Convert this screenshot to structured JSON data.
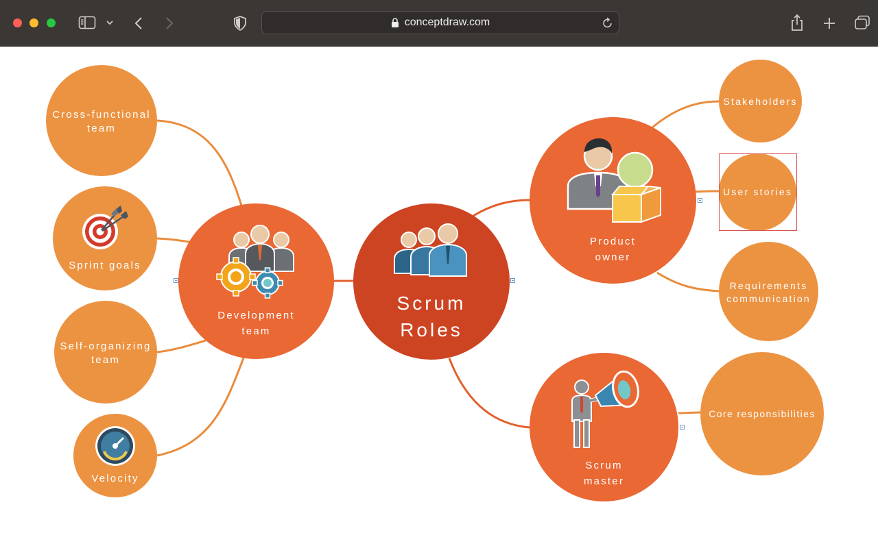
{
  "browser": {
    "url": "conceptdraw.com",
    "icons": [
      "close-dot",
      "minimize-dot",
      "zoom-dot",
      "sidebar-icon",
      "chevron-down-icon",
      "back-icon",
      "forward-icon",
      "privacy-shield-icon",
      "lock-icon",
      "reload-icon",
      "share-icon",
      "new-tab-icon",
      "tabs-overview-icon"
    ]
  },
  "mindmap": {
    "center": {
      "line1": "Scrum",
      "line2": "Roles"
    },
    "development": {
      "line1": "Development",
      "line2": "team",
      "children": {
        "cross_functional": {
          "line1": "Cross-functional",
          "line2": "team"
        },
        "sprint_goals": {
          "label": "Sprint goals"
        },
        "self_organizing": {
          "line1": "Self-organizing",
          "line2": "team"
        },
        "velocity": {
          "label": "Velocity"
        }
      }
    },
    "product_owner": {
      "line1": "Product",
      "line2": "owner",
      "children": {
        "stakeholders": {
          "label": "Stakeholders"
        },
        "user_stories": {
          "label": "User stories"
        },
        "requirements": {
          "line1": "Requirements",
          "line2": "communication"
        }
      }
    },
    "scrum_master": {
      "line1": "Scrum",
      "line2": "master",
      "children": {
        "core": {
          "label": "Core responsibilities"
        }
      }
    },
    "colors": {
      "leaf": "#ec9342",
      "mid": "#e96834",
      "center": "#cd4423",
      "link_leaf": "#e98c3c",
      "link_main": "#e2602c",
      "selection": "#d9534f"
    }
  }
}
